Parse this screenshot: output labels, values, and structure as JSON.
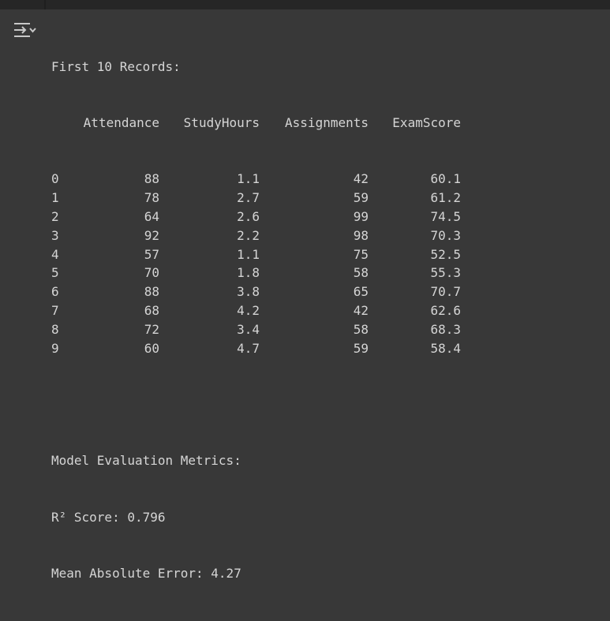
{
  "output": {
    "toggle_icon": "output-collapse-icon",
    "records_heading": "First 10 Records:",
    "table": {
      "columns": [
        "Attendance",
        "StudyHours",
        "Assignments",
        "ExamScore"
      ],
      "rows": [
        {
          "index": "0",
          "Attendance": "88",
          "StudyHours": "1.1",
          "Assignments": "42",
          "ExamScore": "60.1"
        },
        {
          "index": "1",
          "Attendance": "78",
          "StudyHours": "2.7",
          "Assignments": "59",
          "ExamScore": "61.2"
        },
        {
          "index": "2",
          "Attendance": "64",
          "StudyHours": "2.6",
          "Assignments": "99",
          "ExamScore": "74.5"
        },
        {
          "index": "3",
          "Attendance": "92",
          "StudyHours": "2.2",
          "Assignments": "98",
          "ExamScore": "70.3"
        },
        {
          "index": "4",
          "Attendance": "57",
          "StudyHours": "1.1",
          "Assignments": "75",
          "ExamScore": "52.5"
        },
        {
          "index": "5",
          "Attendance": "70",
          "StudyHours": "1.8",
          "Assignments": "58",
          "ExamScore": "55.3"
        },
        {
          "index": "6",
          "Attendance": "88",
          "StudyHours": "3.8",
          "Assignments": "65",
          "ExamScore": "70.7"
        },
        {
          "index": "7",
          "Attendance": "68",
          "StudyHours": "4.2",
          "Assignments": "42",
          "ExamScore": "62.6"
        },
        {
          "index": "8",
          "Attendance": "72",
          "StudyHours": "3.4",
          "Assignments": "58",
          "ExamScore": "68.3"
        },
        {
          "index": "9",
          "Attendance": "60",
          "StudyHours": "4.7",
          "Assignments": "59",
          "ExamScore": "58.4"
        }
      ]
    },
    "metrics_heading": "Model Evaluation Metrics:",
    "r2_line": "R² Score: 0.796",
    "mae_line": "Mean Absolute Error: 4.27"
  }
}
